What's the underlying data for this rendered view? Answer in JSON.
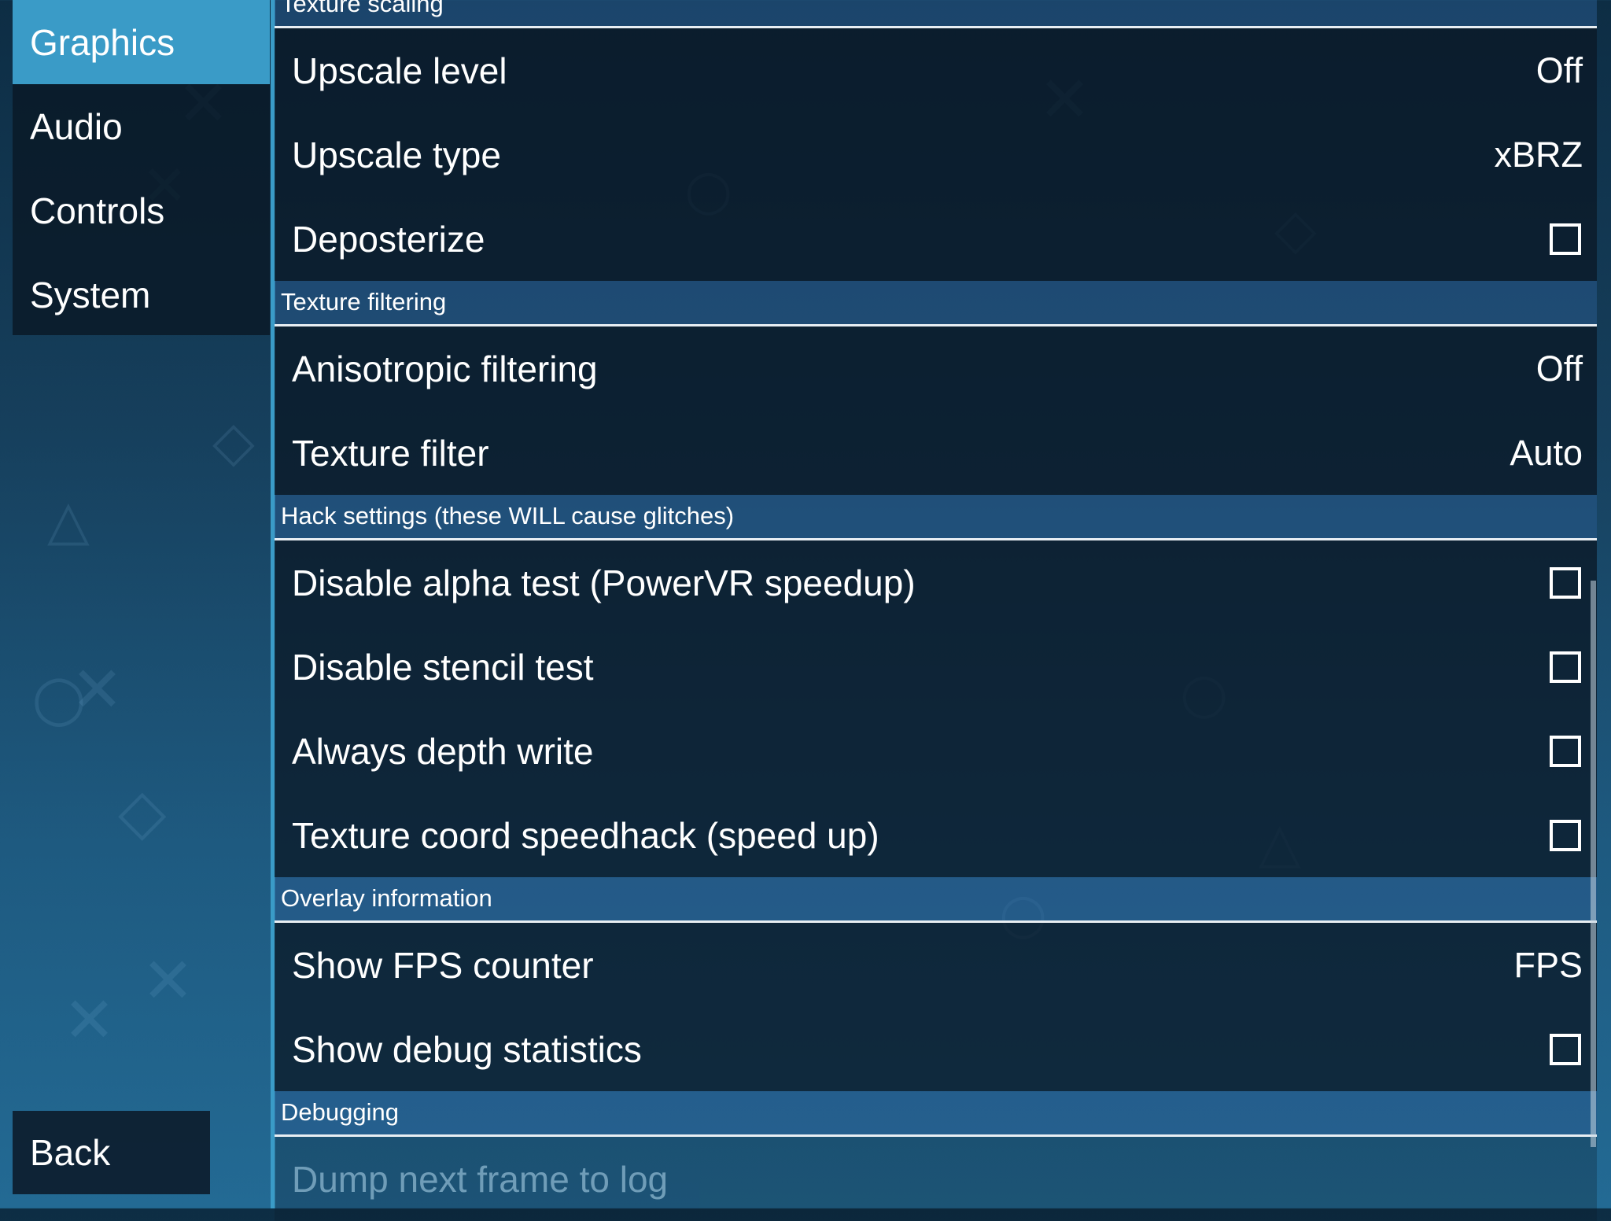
{
  "sidebar": {
    "items": [
      {
        "label": "Graphics",
        "active": true
      },
      {
        "label": "Audio",
        "active": false
      },
      {
        "label": "Controls",
        "active": false
      },
      {
        "label": "System",
        "active": false
      }
    ],
    "back_label": "Back"
  },
  "sections": {
    "texture_scaling": {
      "title": "Texture scaling",
      "upscale_level": {
        "label": "Upscale level",
        "value": "Off"
      },
      "upscale_type": {
        "label": "Upscale type",
        "value": "xBRZ"
      },
      "deposterize": {
        "label": "Deposterize",
        "checked": false
      }
    },
    "texture_filtering": {
      "title": "Texture filtering",
      "anisotropic": {
        "label": "Anisotropic filtering",
        "value": "Off"
      },
      "texture_filter": {
        "label": "Texture filter",
        "value": "Auto"
      }
    },
    "hack_settings": {
      "title": "Hack settings (these WILL cause glitches)",
      "disable_alpha": {
        "label": "Disable alpha test (PowerVR speedup)",
        "checked": false
      },
      "disable_stencil": {
        "label": "Disable stencil test",
        "checked": false
      },
      "always_depth": {
        "label": "Always depth write",
        "checked": false
      },
      "texture_coord": {
        "label": "Texture coord speedhack (speed up)",
        "checked": false
      }
    },
    "overlay": {
      "title": "Overlay information",
      "show_fps": {
        "label": "Show FPS counter",
        "value": "FPS"
      },
      "show_debug": {
        "label": "Show debug statistics",
        "checked": false
      }
    },
    "debugging": {
      "title": "Debugging",
      "dump_frame": {
        "label": "Dump next frame to log"
      }
    }
  },
  "colors": {
    "accent": "#3a9bc7",
    "panel": "#0a1826",
    "section_header": "#285a8c"
  }
}
